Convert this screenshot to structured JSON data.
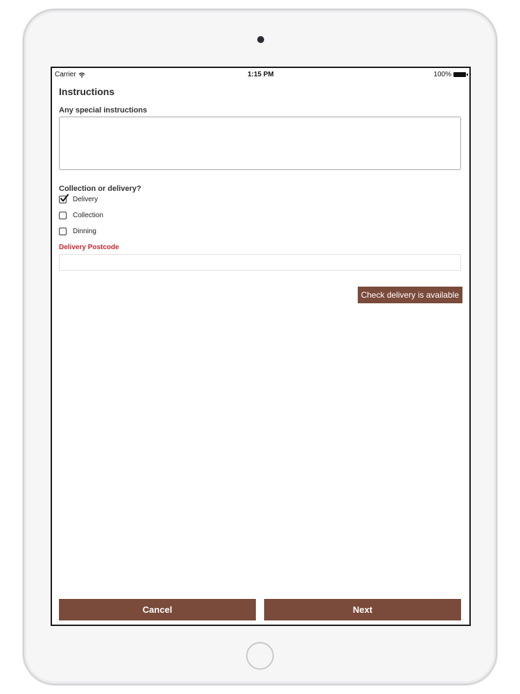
{
  "status_bar": {
    "carrier": "Carrier",
    "time": "1:15 PM",
    "battery": "100%"
  },
  "form": {
    "title": "Instructions",
    "instructions_label": "Any special instructions",
    "instructions_value": "",
    "collection_label": "Collection or delivery?",
    "options": [
      {
        "label": "Delivery",
        "checked": true
      },
      {
        "label": "Collection",
        "checked": false
      },
      {
        "label": "Dinning",
        "checked": false
      }
    ],
    "postcode_label": "Delivery Postcode",
    "postcode_value": "",
    "check_button_label": "Check delivery is available"
  },
  "footer": {
    "cancel_label": "Cancel",
    "next_label": "Next"
  },
  "colors": {
    "button_bg": "#7a4a3a",
    "postcode_label": "#c4282f"
  }
}
